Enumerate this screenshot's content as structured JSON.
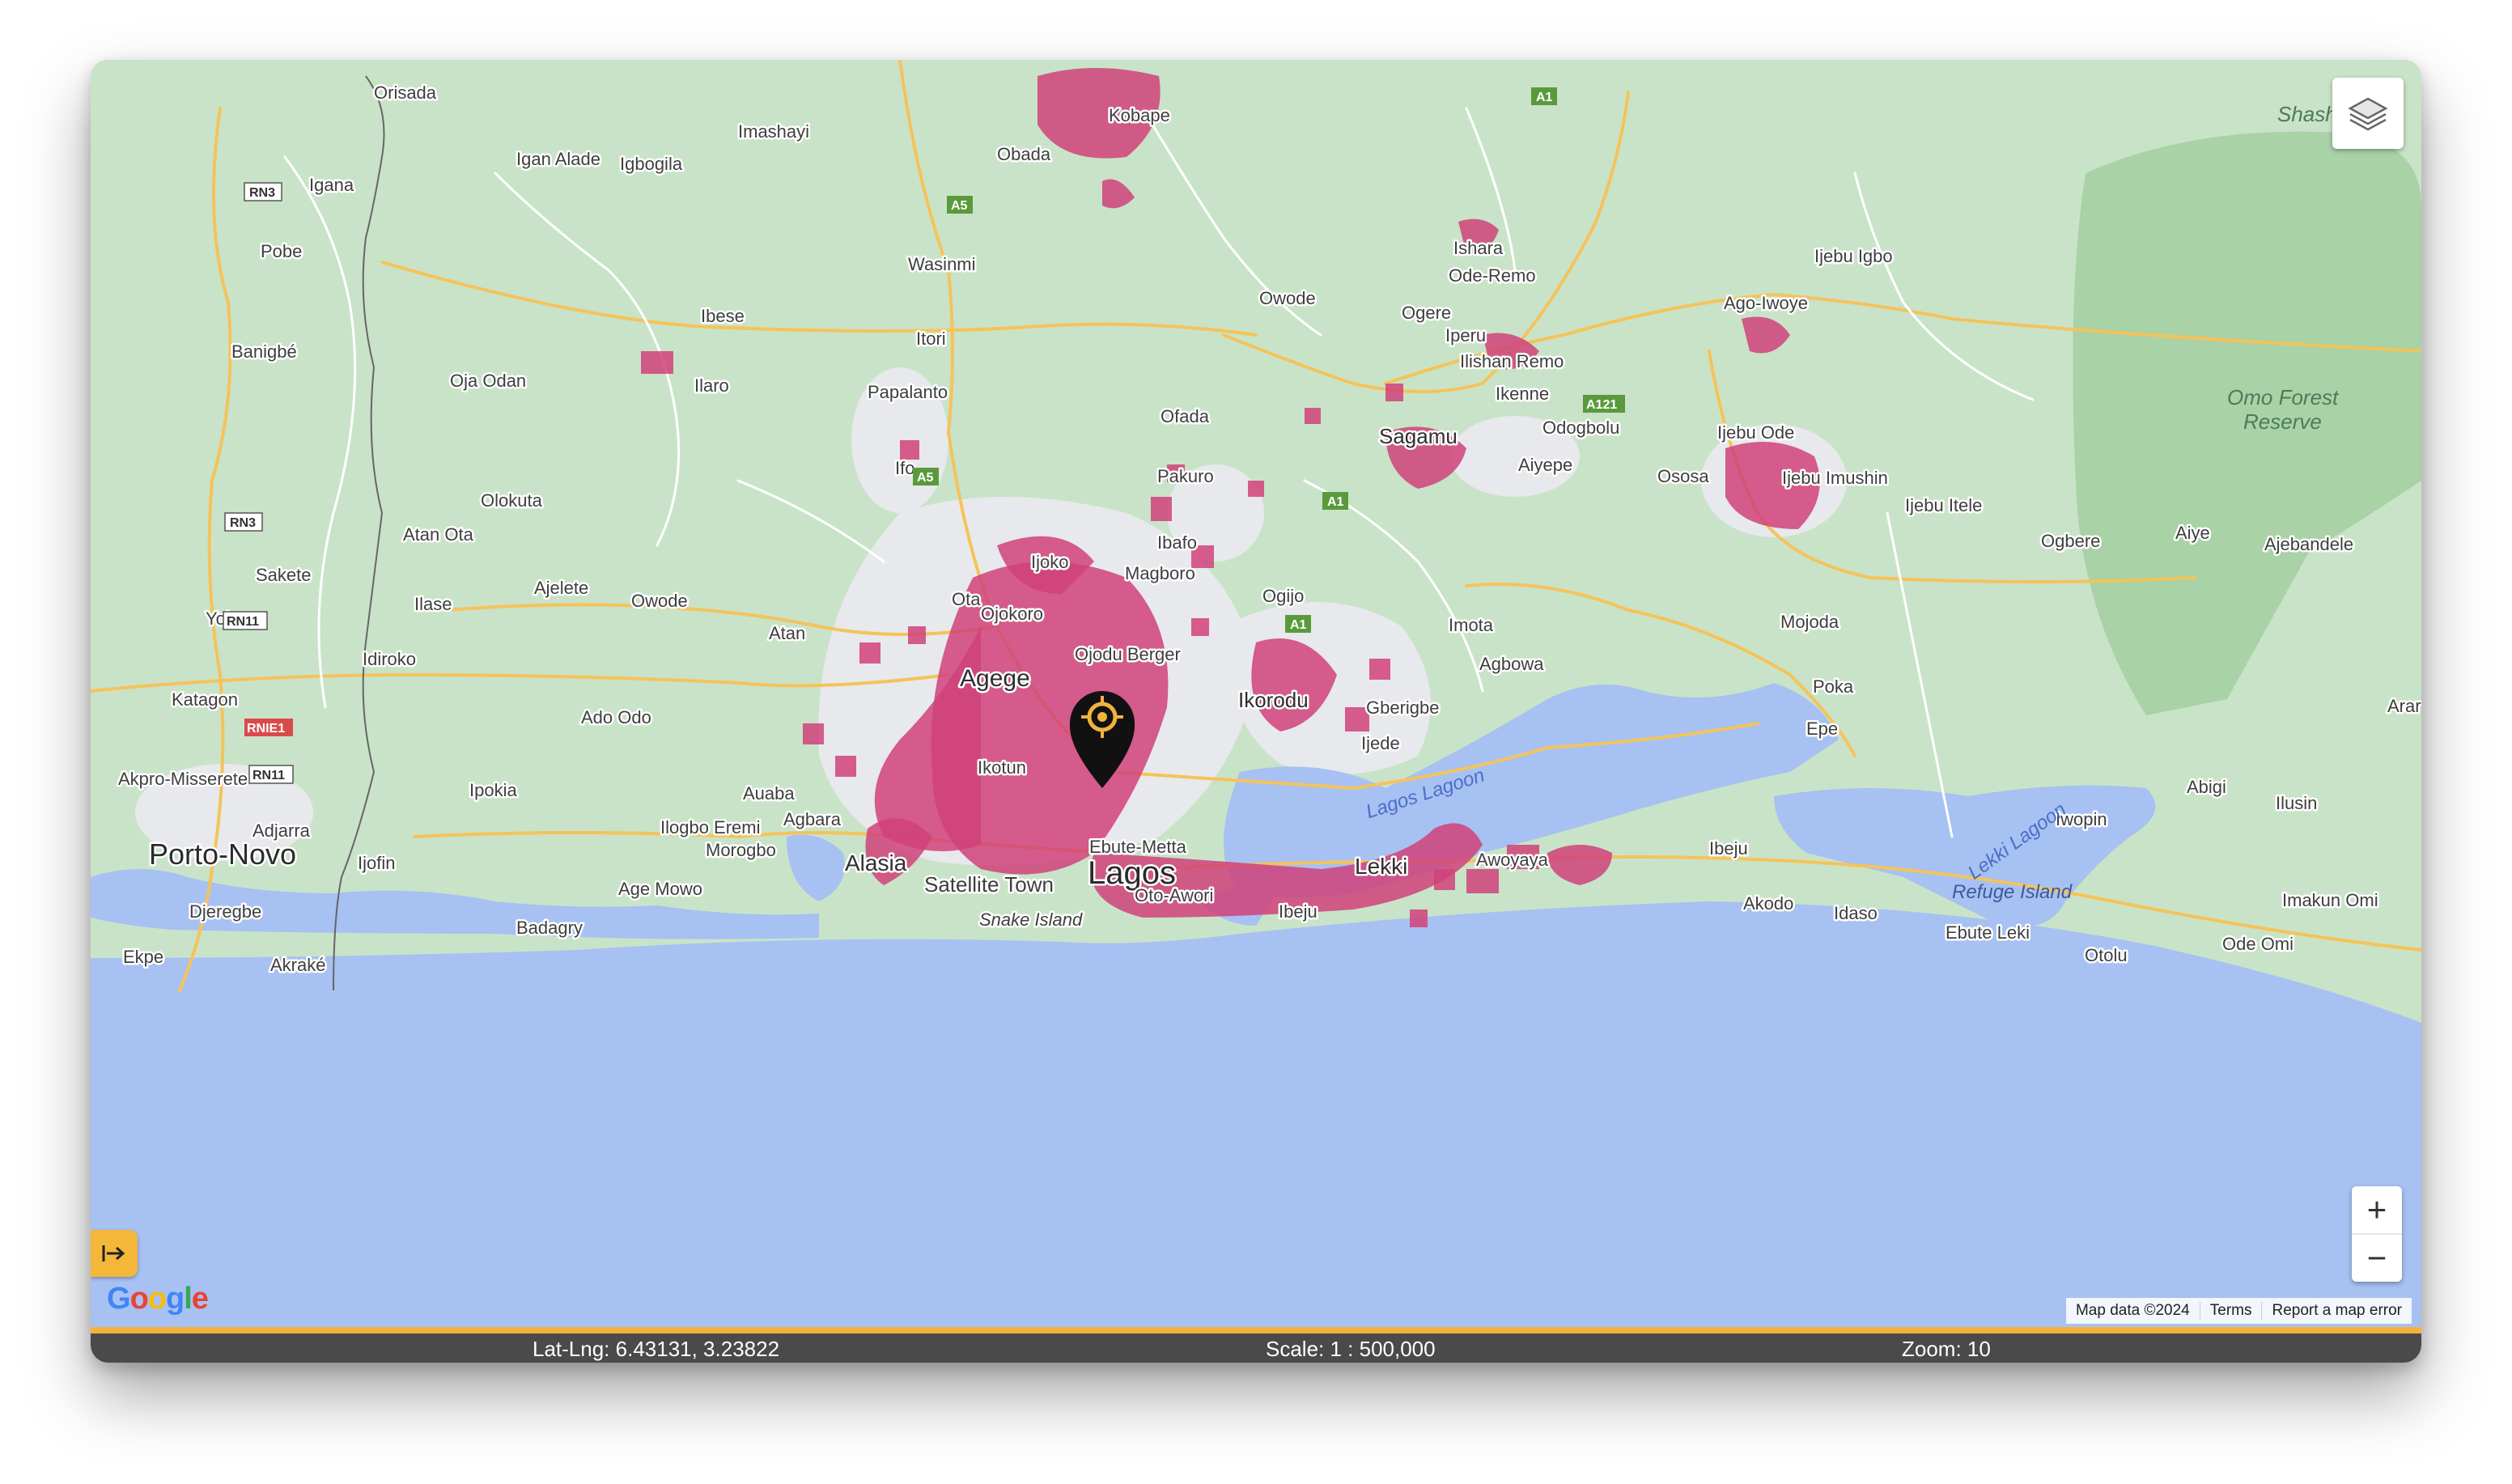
{
  "map": {
    "labels": {
      "lagos": "Lagos",
      "agege": "Agege",
      "ikorodu": "Ikorodu",
      "lekki": "Lekki",
      "alasia": "Alasia",
      "porto_novo": "Porto-Novo",
      "sagamu": "Sagamu",
      "satellite_town": "Satellite Town",
      "ebute_metta": "Ebute-Metta",
      "oto_awori": "Oto-Awori",
      "ikotun": "Ikotun",
      "ojodu_berger": "Ojodu Berger",
      "ojokoro": "Ojokoro",
      "ijoko": "Ijoko",
      "magboro": "Magboro",
      "ibafo": "Ibafo",
      "ota": "Ota",
      "atan": "Atan",
      "owode_w": "Owode",
      "ajelete": "Ajelete",
      "ilase": "Ilase",
      "idiroko": "Idiroko",
      "ado_odo": "Ado Odo",
      "ipokia": "Ipokia",
      "auaba": "Auaba",
      "agbara": "Agbara",
      "ilogbo_eremi": "Ilogbo Eremi",
      "morogbo": "Morogbo",
      "age_mowo": "Age Mowo",
      "badagry": "Badagry",
      "snake_island": "Snake Island",
      "ibeju": "Ibeju",
      "awoyaya": "Awoyaya",
      "akodo": "Akodo",
      "idaso": "Idaso",
      "ebute_leki": "Ebute Leki",
      "otolu": "Otolu",
      "ode_omi": "Ode Omi",
      "imakun_omi": "Imakun Omi",
      "ilusin": "Ilusin",
      "abigi": "Abigi",
      "iwopin": "Iwopin",
      "refuge_island": "Refuge Island",
      "lekki_lagoon": "Lekki Lagoon",
      "lagos_lagoon": "Lagos Lagoon",
      "ibeju_n": "Ibeju",
      "epe": "Epe",
      "poka": "Poka",
      "mojoda": "Mojoda",
      "imota": "Imota",
      "agbowa": "Agbowa",
      "gberigbe": "Gberigbe",
      "ijede": "Ijede",
      "ogijo": "Ogijo",
      "pakuro": "Pakuro",
      "ofada": "Ofada",
      "ifo": "Ifo",
      "papalanto": "Papalanto",
      "itori": "Itori",
      "ilaro": "Ilaro",
      "oja_odan": "Oja Odan",
      "ibese": "Ibese",
      "wasinmi": "Wasinmi",
      "olokuta": "Olokuta",
      "atan_ota": "Atan Ota",
      "sakete": "Sakete",
      "yoko": "Yoko",
      "katagon": "Katagon",
      "akpro": "Akpro-Misserete",
      "adjarra": "Adjarra",
      "ijofin": "Ijofin",
      "djeregbe": "Djeregbe",
      "ekpe": "Ekpe",
      "akrake": "Akraké",
      "banigbe": "Banigbé",
      "pobe": "Pobe",
      "igana": "Igana",
      "igan_alade": "Igan Alade",
      "igbogila": "Igbogila",
      "imashayi": "Imashayi",
      "orisada": "Orisada",
      "obada": "Obada",
      "kobape": "Kobape",
      "owode_n": "Owode",
      "ogere": "Ogere",
      "ishara": "Ishara",
      "ode_remo": "Ode-Remo",
      "iperu": "Iperu",
      "ilishan_remo": "Ilishan Remo",
      "ikenne": "Ikenne",
      "odogbolu": "Odogbolu",
      "aiyepe": "Aiyepe",
      "ososa": "Ososa",
      "ijebu_ode": "Ijebu Ode",
      "ijebu_imushin": "Ijebu Imushin",
      "ijebu_itele": "Ijebu Itele",
      "ogbere": "Ogbere",
      "aiye": "Aiye",
      "ajebandele": "Ajebandele",
      "ago_iwoye": "Ago-Iwoye",
      "ijebu_igbo": "Ijebu Igbo",
      "omo_forest": "Omo Forest",
      "reserve": "Reserve",
      "shasha": "Shasha",
      "arar": "Arar"
    },
    "shields": {
      "rn3a": "RN3",
      "rn3b": "RN3",
      "rn11a": "RN11",
      "rn11b": "RN11",
      "rnie1": "RNIE1",
      "a5a": "A5",
      "a5b": "A5",
      "a1a": "A1",
      "a1b": "A1",
      "a1c": "A1",
      "a121": "A121"
    }
  },
  "controls": {
    "zoom_in": "+",
    "zoom_out": "−",
    "layers_icon": "layers-icon",
    "panel_toggle_icon": "arrow-right-to-bar-icon"
  },
  "google_logo": {
    "letters": [
      "G",
      "o",
      "o",
      "g",
      "l",
      "e"
    ],
    "colors": [
      "#4285F4",
      "#EA4335",
      "#FBBC05",
      "#4285F4",
      "#34A853",
      "#EA4335"
    ]
  },
  "attribution": {
    "map_data": "Map data ©2024",
    "terms": "Terms",
    "report": "Report a map error"
  },
  "status": {
    "latlng": "Lat-Lng: 6.43131, 3.23822",
    "scale": "Scale: 1 : 500,000",
    "zoom": "Zoom: 10"
  },
  "colors": {
    "land": "#c9e3c8",
    "water": "#a7c1f2",
    "urban": "#e8e9ec",
    "density": "#d0427a",
    "road": "#f5c35a",
    "accent": "#f2b33c",
    "statusbar": "#4a4a4a"
  }
}
